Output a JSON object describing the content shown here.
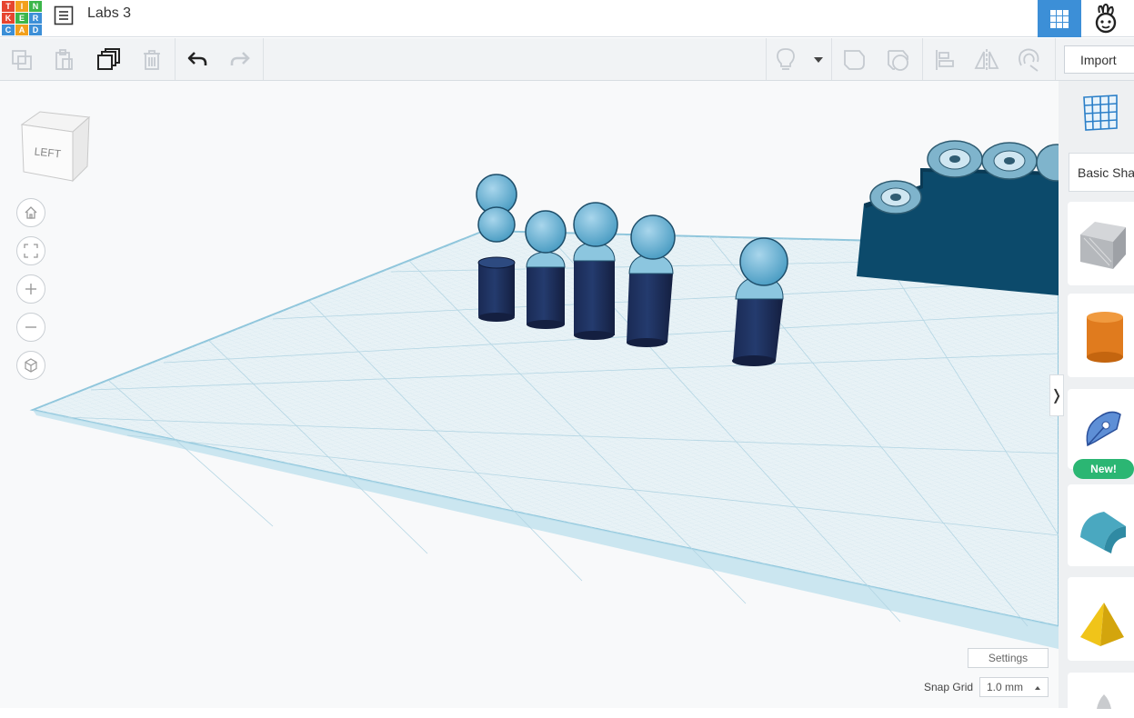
{
  "app": {
    "logo_letters": [
      "T",
      "I",
      "N",
      "K",
      "E",
      "R",
      "C",
      "A",
      "D"
    ],
    "logo_colors": [
      "#e6452f",
      "#f2a01d",
      "#3cb64a",
      "#e6452f",
      "#3cb64a",
      "#3c8fd7",
      "#3c8fd7",
      "#f2a01d",
      "#3c8fd7"
    ],
    "design_title": "Labs 3",
    "accent": "#3c8fd7"
  },
  "toolbar": {
    "items": [
      "copy-icon",
      "paste-icon",
      "duplicate-icon",
      "delete-icon",
      "undo-icon",
      "redo-icon",
      "show-all-icon",
      "dropdown-icon",
      "group-icon",
      "ungroup-icon",
      "align-icon",
      "mirror-icon",
      "workplane-magnet-icon"
    ],
    "import_label": "Import"
  },
  "viewport": {
    "view_cube_label": "LEFT",
    "nav_buttons": [
      "home-view-icon",
      "fit-view-icon",
      "zoom-in-icon",
      "zoom-out-icon",
      "projection-icon"
    ],
    "settings_label": "Settings",
    "snap_grid_label": "Snap Grid",
    "snap_grid_value": "1.0 mm"
  },
  "shapes_panel": {
    "category_label": "Basic Shapes",
    "shapes": [
      "workplane-icon",
      "box-icon",
      "cylinder-icon",
      "scribble-icon",
      "roof-icon",
      "pyramid-icon"
    ],
    "new_badge": "New!",
    "colors": {
      "box": "#b7b9bd",
      "cylinder": "#e07b1e",
      "roof": "#4aa8c0",
      "pyramid": "#f0c419",
      "scribble": "#3c7cc7"
    }
  }
}
